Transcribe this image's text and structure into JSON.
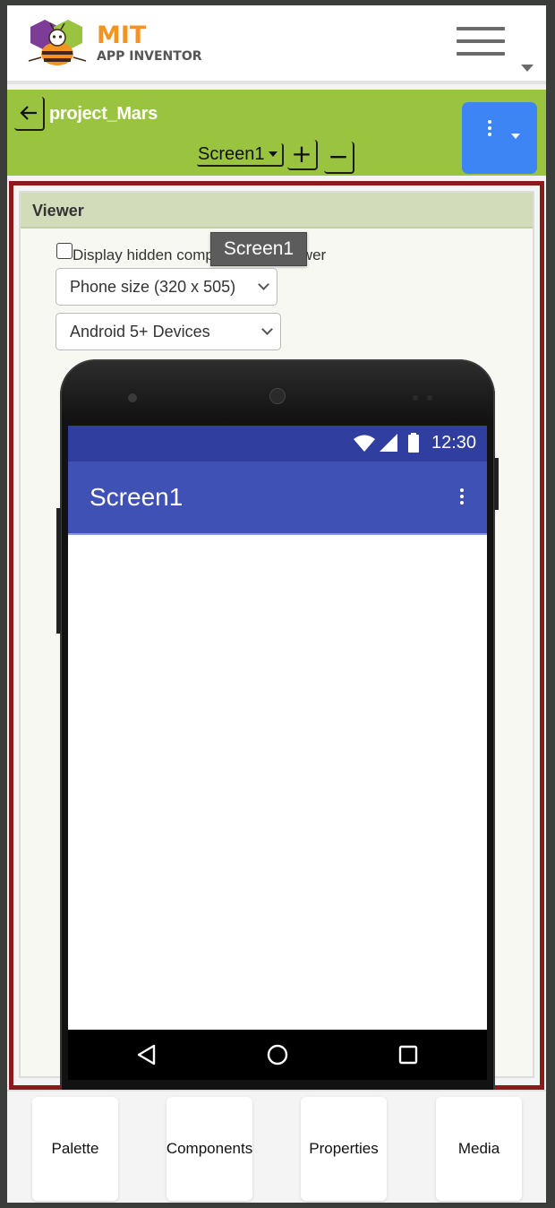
{
  "header": {
    "brand_title": "MIT",
    "brand_subtitle": "APP INVENTOR",
    "logo_icon": "mit-bee-logo-icon",
    "menu_icon": "hamburger-icon"
  },
  "project_bar": {
    "project_name": "project_Mars",
    "back_icon": "arrow-left-icon",
    "screen_selected": "Screen1",
    "add_screen_label": "+",
    "remove_screen_label": "−",
    "more_icon": "vertical-dots-icon",
    "accent_color": "#9ac440",
    "more_button_color": "#3d85f5"
  },
  "viewer": {
    "title": "Viewer",
    "hidden_components_label": "Display hidden components in Viewer",
    "hidden_components_checked": false,
    "tooltip": "Screen1",
    "size_select_value": "Phone size (320 x 505)",
    "device_select_value": "Android 5+ Devices",
    "border_color": "#8b1a1a"
  },
  "phone": {
    "status_time": "12:30",
    "screen_title": "Screen1",
    "status_bar_color": "#303f9f",
    "app_bar_color": "#3f51b5",
    "nav_back_icon": "triangle-back-icon",
    "nav_home_icon": "circle-home-icon",
    "nav_recents_icon": "square-recents-icon"
  },
  "tabs": [
    {
      "label": "Palette"
    },
    {
      "label": "Components"
    },
    {
      "label": "Properties"
    },
    {
      "label": "Media"
    }
  ]
}
